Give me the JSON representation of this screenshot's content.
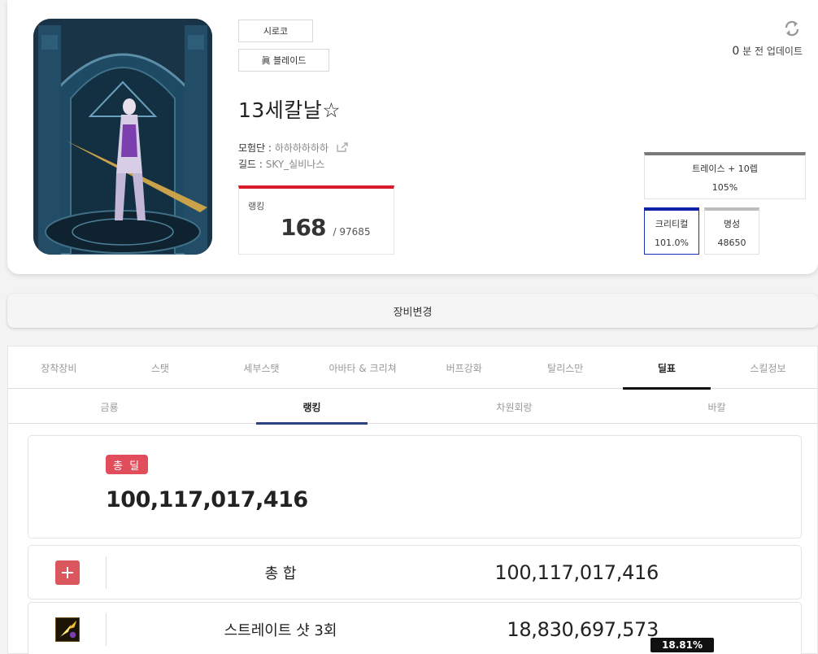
{
  "profile": {
    "server": "시로코",
    "job": "眞 블레이드",
    "name": "13세칼날☆",
    "adventure_label": "모험단 :",
    "adventure_value": "하하하하하하",
    "guild_label": "길드 :",
    "guild_value": "SKY_실비나스",
    "rank_label": "랭킹",
    "rank_value": "168",
    "rank_total": "/ 97685",
    "update_num": "0",
    "update_suffix": "분 전 업데이트"
  },
  "stats": {
    "wide": {
      "title": "트레이스 + 10렙",
      "value": "105%"
    },
    "crit": {
      "title": "크리티컬",
      "value": "101.0%"
    },
    "fame": {
      "title": "명성",
      "value": "48650"
    }
  },
  "equip_change_label": "장비변경",
  "main_tabs": [
    {
      "label": "장착장비"
    },
    {
      "label": "스탯"
    },
    {
      "label": "세부스탯"
    },
    {
      "label": "아바타 & 크리쳐"
    },
    {
      "label": "버프강화"
    },
    {
      "label": "탈리스만"
    },
    {
      "label": "딜표"
    },
    {
      "label": "스킬정보"
    }
  ],
  "sub_tabs": [
    {
      "label": "금룡"
    },
    {
      "label": "랭킹"
    },
    {
      "label": "차원회랑"
    },
    {
      "label": "바칼"
    }
  ],
  "total": {
    "badge": "총 딜",
    "value": "100,117,017,416"
  },
  "rows": [
    {
      "name": "총 합",
      "value": "100,117,017,416"
    },
    {
      "name": "스트레이트 샷 3회",
      "value": "18,830,697,573",
      "percent": "18.81%"
    }
  ],
  "colors": {
    "rank_accent": "#d91a2a",
    "crit_accent": "#0e22a8",
    "badge_red": "#e14d5b",
    "active_tab": "#111111",
    "active_subtab": "#2c4286"
  }
}
